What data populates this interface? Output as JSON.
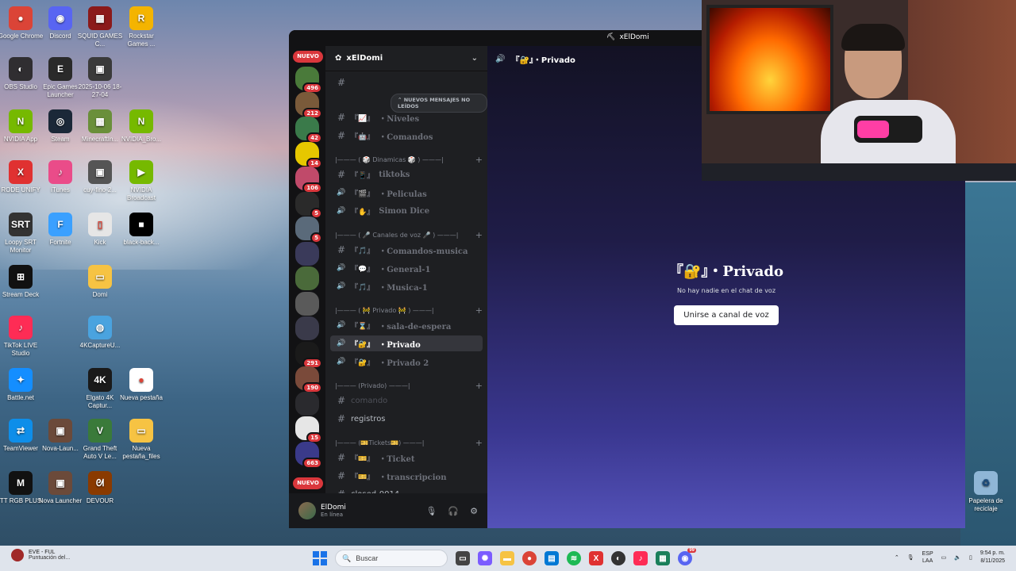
{
  "desktop": {
    "icons": [
      {
        "label": "Google Chrome",
        "glyph": "●",
        "color": "#db4437"
      },
      {
        "label": "Discord",
        "glyph": "◉",
        "color": "#5865f2"
      },
      {
        "label": "SQUID GAMES C...",
        "glyph": "▦",
        "color": "#8b1a1a"
      },
      {
        "label": "Rockstar Games ...",
        "glyph": "R",
        "color": "#f4b400"
      },
      {
        "label": "OBS Studio",
        "glyph": "◐",
        "color": "#302e31"
      },
      {
        "label": "Epic Games Launcher",
        "glyph": "E",
        "color": "#2a2a2a"
      },
      {
        "label": "2025-10-06 18-27-04",
        "glyph": "▣",
        "color": "#3a3a3a"
      },
      {
        "label": "NVIDIA App",
        "glyph": "N",
        "color": "#76b900"
      },
      {
        "label": "Steam",
        "glyph": "◎",
        "color": "#1b2838"
      },
      {
        "label": "MinecraftIn...",
        "glyph": "▩",
        "color": "#6a8f3a"
      },
      {
        "label": "NVIDIA_Bro...",
        "glyph": "N",
        "color": "#76b900"
      },
      {
        "label": "RODE UNIFY",
        "glyph": "X",
        "color": "#e03131"
      },
      {
        "label": "iTunes",
        "glyph": "♪",
        "color": "#ea4c89"
      },
      {
        "label": "cuy-fino-2...",
        "glyph": "▣",
        "color": "#555"
      },
      {
        "label": "NVIDIA Broadcast",
        "glyph": "▶",
        "color": "#76b900"
      },
      {
        "label": "Loopy SRT Monitor",
        "glyph": "SRT",
        "color": "#333"
      },
      {
        "label": "Fortnite",
        "glyph": "F",
        "color": "#3aa0ff"
      },
      {
        "label": "Kick",
        "glyph": "▯",
        "color": "#e6e6e6"
      },
      {
        "label": "black-back...",
        "glyph": "■",
        "color": "#000"
      },
      {
        "label": "Stream Deck",
        "glyph": "⊞",
        "color": "#111"
      },
      {
        "label": "Domi",
        "glyph": "▭",
        "color": "#f6c343"
      },
      {
        "label": "TikTok LIVE Studio",
        "glyph": "♪",
        "color": "#fe2c55"
      },
      {
        "label": "4KCaptureU...",
        "glyph": "◍",
        "color": "#4aa3df"
      },
      {
        "label": "Battle.net",
        "glyph": "✦",
        "color": "#148eff"
      },
      {
        "label": "Elgato 4K Captur...",
        "glyph": "4K",
        "color": "#1a1a1a"
      },
      {
        "label": "Nueva pestaña",
        "glyph": "●",
        "color": "#ffffff"
      },
      {
        "label": "TeamViewer",
        "glyph": "⇄",
        "color": "#0e8ee9"
      },
      {
        "label": "Nova-Laun...",
        "glyph": "▣",
        "color": "#6b4a3a"
      },
      {
        "label": "Grand Theft Auto V Le...",
        "glyph": "V",
        "color": "#3a7a3a"
      },
      {
        "label": "Nueva pestaña_files",
        "glyph": "▭",
        "color": "#f6c343"
      },
      {
        "label": "TT RGB PLUS",
        "glyph": "M",
        "color": "#111"
      },
      {
        "label": "Nova Launcher",
        "glyph": "▣",
        "color": "#6b4a3a"
      },
      {
        "label": "DEVOUR",
        "glyph": "ᘛ",
        "color": "#8a3a00"
      }
    ],
    "recycle_bin": {
      "label": "Papelera de reciclaje"
    }
  },
  "discord": {
    "window_title": "xElDomi",
    "server_name": "xElDomi",
    "nuevo_top": "NUEVO",
    "nuevo_bottom": "NUEVO",
    "servers": [
      {
        "badge": "496",
        "color": "#4a7a3a"
      },
      {
        "badge": "212",
        "color": "#7a5a3a"
      },
      {
        "badge": "42",
        "color": "#3a7a4a"
      },
      {
        "badge": "14",
        "color": "#e6c700"
      },
      {
        "badge": "106",
        "color": "#c04a6a"
      },
      {
        "badge": "5",
        "color": "#2a2a2a"
      },
      {
        "badge": "5",
        "color": "#5a6a7a"
      },
      {
        "badge": "",
        "color": "#3a3a5a"
      },
      {
        "badge": "",
        "color": "#4a6a3a"
      },
      {
        "badge": "",
        "color": "#5a5a5a"
      },
      {
        "badge": "",
        "color": "#3a3a4a"
      },
      {
        "badge": "291",
        "color": "#1a1a1a"
      },
      {
        "badge": "190",
        "color": "#7a4a3a"
      },
      {
        "badge": "",
        "color": "#2a2a2e"
      },
      {
        "badge": "15",
        "color": "#e6e6e6"
      },
      {
        "badge": "663",
        "color": "#3a3a8a"
      }
    ],
    "new_messages_pill": "NUEVOS MENSAJES NO LEÍDOS",
    "channels": [
      {
        "type": "text",
        "emoji": "『📈』",
        "name": "・Niveles"
      },
      {
        "type": "text",
        "emoji": "『🤖』",
        "name": "・Comandos"
      },
      {
        "type": "category",
        "name": "|——— ( 🎲 Dinamicas 🎲 ) ———|"
      },
      {
        "type": "text",
        "emoji": "『📱』",
        "name": "tiktoks"
      },
      {
        "type": "voice",
        "emoji": "『🎬』",
        "name": "・Peliculas"
      },
      {
        "type": "voice",
        "emoji": "『✋』",
        "name": "Simon Dice"
      },
      {
        "type": "category",
        "name": "|——— ( 🎤 Canales de voz 🎤 ) ———|"
      },
      {
        "type": "text",
        "emoji": "『🎵』",
        "name": "・Comandos-musica"
      },
      {
        "type": "voice",
        "emoji": "『💬』",
        "name": "・General-1"
      },
      {
        "type": "voice",
        "emoji": "『🎵』",
        "name": "・Musica-1"
      },
      {
        "type": "category",
        "name": "|——— ( 🚧 Privado 🚧 ) ———|"
      },
      {
        "type": "voice",
        "emoji": "『⌛』",
        "name": "・sala-de-espera"
      },
      {
        "type": "voice",
        "emoji": "『🔐』",
        "name": "・Privado"
      },
      {
        "type": "voice",
        "emoji": "『🔐』",
        "name": "・Privado 2"
      },
      {
        "type": "category",
        "name": "|——— (Privado) ———|"
      },
      {
        "type": "text",
        "emoji": "",
        "name": "comando"
      },
      {
        "type": "text",
        "emoji": "",
        "name": "registros"
      },
      {
        "type": "category",
        "name": "|——— (🎫Tickets🎫) ———|"
      },
      {
        "type": "text",
        "emoji": "『🎫』",
        "name": "・Ticket"
      },
      {
        "type": "text",
        "emoji": "『🎫』",
        "name": "・transcripcion"
      },
      {
        "type": "text",
        "emoji": "",
        "name": "closed-0014"
      }
    ],
    "active_channel": "『🔐』・Privado",
    "main": {
      "header_title": "『🔐』・Privado",
      "big_title": "『🔐』・Privado",
      "empty_text": "No hay nadie en el chat de voz",
      "join_button": "Unirse a canal de voz"
    },
    "user": {
      "name": "ElDomi",
      "status": "En línea"
    }
  },
  "taskbar": {
    "notif_title": "EVE - FUL",
    "notif_sub": "Puntuación del...",
    "search_placeholder": "Buscar",
    "lang_top": "ESP",
    "lang_bottom": "LAA",
    "time": "9:54 p. m.",
    "date": "8/11/2025",
    "discord_badge": "99"
  }
}
